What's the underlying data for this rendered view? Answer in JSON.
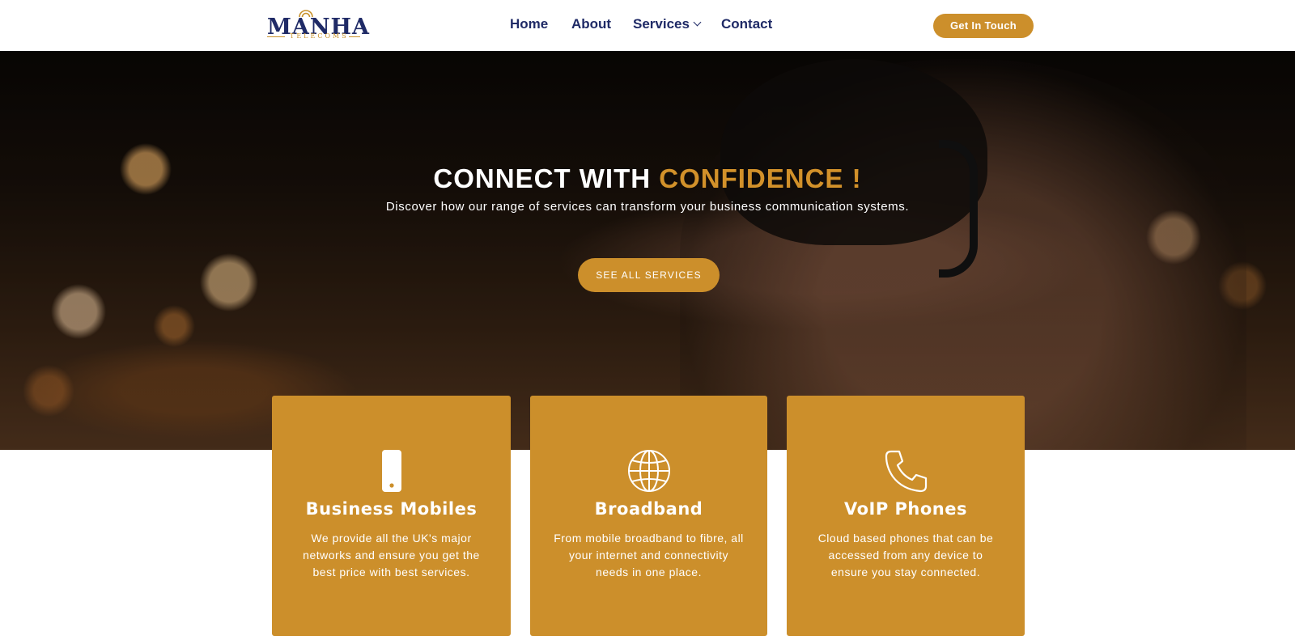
{
  "brand": {
    "logo_name": "MANHA",
    "logo_tagline": "TELECOMS"
  },
  "nav": {
    "items": [
      {
        "label": "Home"
      },
      {
        "label": "About"
      },
      {
        "label": "Services"
      },
      {
        "label": "Contact"
      }
    ],
    "cta_label": "Get In Touch"
  },
  "hero": {
    "title_main": "CONNECT WITH",
    "title_accent": "CONFIDENCE !",
    "subtitle": "Discover how our range of services can transform your business communication systems.",
    "button_label": "SEE ALL SERVICES"
  },
  "services": [
    {
      "icon": "smartphone-icon",
      "title": "Business Mobiles",
      "text": "We provide all the UK's major networks and ensure you get the best price with best services."
    },
    {
      "icon": "globe-icon",
      "title": "Broadband",
      "text": "From mobile broadband to fibre, all your internet and connectivity needs in one place."
    },
    {
      "icon": "phone-icon",
      "title": "VoIP Phones",
      "text": "Cloud based phones that can be accessed from any device to ensure you stay connected."
    }
  ],
  "colors": {
    "accent": "#cc8f2b",
    "navy": "#1f2a66",
    "white": "#ffffff"
  }
}
